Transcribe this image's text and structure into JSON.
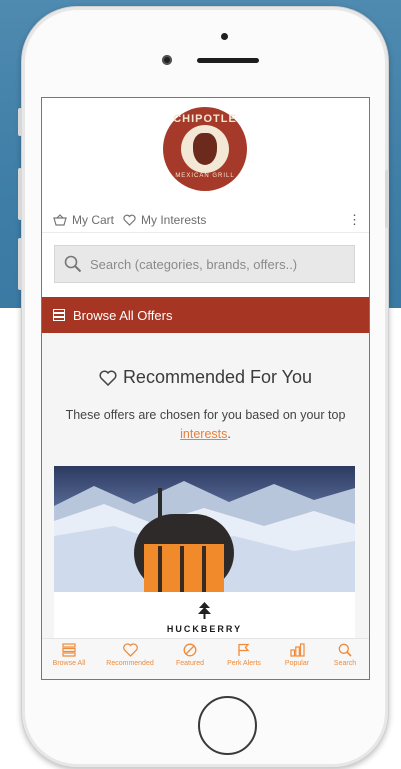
{
  "brand": {
    "logo_top": "CHIPOTLE",
    "logo_bottom": "MEXICAN GRILL"
  },
  "nav": {
    "cart_label": "My Cart",
    "interests_label": "My Interests",
    "more_icon": "kebab-menu-icon"
  },
  "search": {
    "placeholder": "Search (categories, brands, offers..)",
    "value": ""
  },
  "browse": {
    "label": "Browse All Offers"
  },
  "recommended": {
    "title": "Recommended For You",
    "desc_prefix": "These offers are chosen for you based on your top ",
    "desc_link": "interests",
    "desc_suffix": "."
  },
  "offer": {
    "brand": "HUCKBERRY"
  },
  "tabs": [
    {
      "label": "Browse All",
      "icon": "list-icon"
    },
    {
      "label": "Recommended",
      "icon": "heart-icon"
    },
    {
      "label": "Featured",
      "icon": "no-entry-icon"
    },
    {
      "label": "Perk Alerts",
      "icon": "flag-icon"
    },
    {
      "label": "Popular",
      "icon": "bar-chart-icon"
    },
    {
      "label": "Search",
      "icon": "search-icon"
    }
  ],
  "colors": {
    "accent_red": "#a73523",
    "accent_orange": "#ee8b3a",
    "background_blue": "#3f7ea7"
  }
}
